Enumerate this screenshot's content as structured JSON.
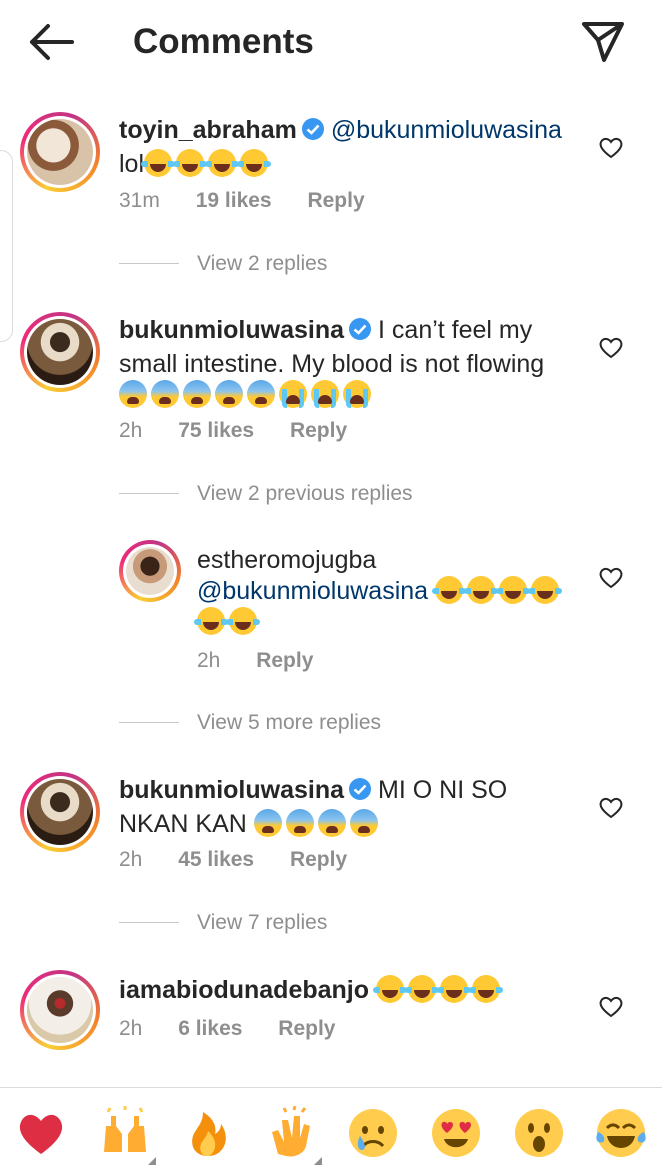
{
  "header": {
    "title": "Comments"
  },
  "comments": [
    {
      "username": "toyin_abraham",
      "mention": "@bukunmioluwasina",
      "text_line2": "lol",
      "time": "31m",
      "likes": "19 likes",
      "reply": "Reply",
      "view_replies": "View 2 replies"
    },
    {
      "username": "bukunmioluwasina",
      "text_line1": "I can’t feel my",
      "text_line2": "small intestine. My blood is not flowing",
      "time": "2h",
      "likes": "75 likes",
      "reply": "Reply",
      "view_replies": "View 2 previous replies"
    },
    {
      "username": "estheromojugba",
      "mention": "@bukunmioluwasina",
      "time": "2h",
      "reply": "Reply",
      "view_replies": "View 5 more replies"
    },
    {
      "username": "bukunmioluwasina",
      "text_line1": "MI O NI SO",
      "text_line2": "NKAN KAN",
      "time": "2h",
      "likes": "45 likes",
      "reply": "Reply",
      "view_replies": "View 7 replies"
    },
    {
      "username": "iamabiodunadebanjo",
      "time": "2h",
      "likes": "6 likes",
      "reply": "Reply"
    }
  ],
  "reaction_bar": [
    "red-heart",
    "raising-hands",
    "fire",
    "clapping-hands",
    "crying-face",
    "heart-eyes",
    "astonished-face",
    "tears-of-joy"
  ],
  "colors": {
    "mention": "#00376b",
    "meta": "#8e8e8e",
    "text": "#262626",
    "verified": "#3897f0"
  }
}
